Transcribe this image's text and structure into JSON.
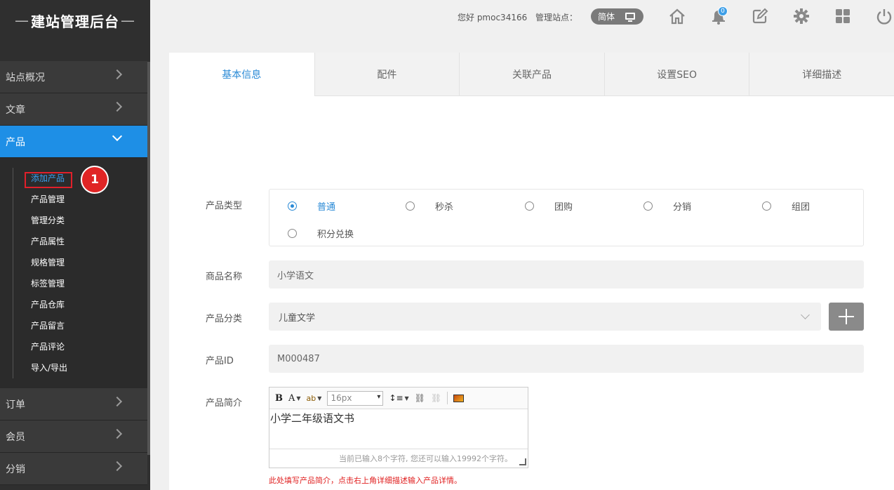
{
  "brand": {
    "title": "建站管理后台",
    "dash_left": "—",
    "dash_right": "—"
  },
  "sidebar": {
    "items": [
      {
        "label": "站点概况"
      },
      {
        "label": "文章"
      },
      {
        "label": "产品"
      },
      {
        "label": "订单"
      },
      {
        "label": "会员"
      },
      {
        "label": "分销"
      }
    ],
    "product_sub": [
      "添加产品",
      "产品管理",
      "管理分类",
      "产品属性",
      "规格管理",
      "标签管理",
      "产品仓库",
      "产品留言",
      "产品评论",
      "导入/导出"
    ]
  },
  "annotation": {
    "step": "1"
  },
  "topbar": {
    "greeting": "您好 pmoc34166",
    "manage_label": "管理站点：",
    "language": "简体",
    "notification_count": "0"
  },
  "tabs": [
    "基本信息",
    "配件",
    "关联产品",
    "设置SEO",
    "详细描述"
  ],
  "form": {
    "type_label": "产品类型",
    "types": [
      "普通",
      "秒杀",
      "团购",
      "分销",
      "组团",
      "积分兑换"
    ],
    "selected_type": "普通",
    "name_label": "商品名称",
    "name_value": "小学语文",
    "category_label": "产品分类",
    "category_value": "儿童文学",
    "id_label": "产品ID",
    "id_value": "M000487",
    "summary_label": "产品简介",
    "editor": {
      "font_size": "16px",
      "content": "小学二年级语文书",
      "counter": "当前已输入8个字符, 您还可以输入19992个字符。"
    },
    "hint": "此处填写产品简介，点击右上角详细描述输入产品详情。"
  },
  "colors": {
    "accent": "#1e8fe6",
    "sidebar_bg": "#2f2f2f",
    "highlight": "#e0202a"
  }
}
